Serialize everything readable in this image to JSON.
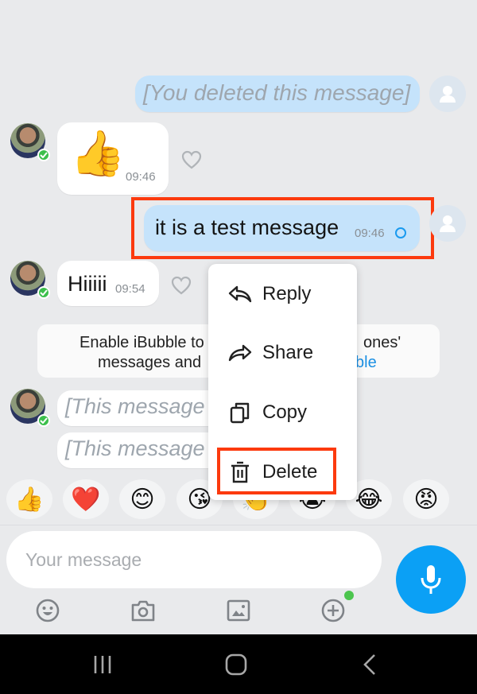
{
  "conversation": {
    "messages": [
      {
        "id": "m1",
        "direction": "outgoing",
        "type": "deleted",
        "text": "[You deleted this message]"
      },
      {
        "id": "m2",
        "direction": "incoming",
        "type": "sticker",
        "sticker": "thumbs-up",
        "glyph": "👍",
        "time": "09:46"
      },
      {
        "id": "m3",
        "direction": "outgoing",
        "type": "text",
        "text": "it is a test message",
        "time": "09:46",
        "status": "sending"
      },
      {
        "id": "m4",
        "direction": "incoming",
        "type": "text",
        "text": "Hiiiii",
        "time": "09:54"
      },
      {
        "id": "m5",
        "direction": "incoming",
        "type": "deleted",
        "text": "[This message"
      },
      {
        "id": "m6",
        "direction": "incoming",
        "type": "deleted",
        "text": "[This message"
      }
    ],
    "banner": {
      "line1_left": "Enable iBubble to",
      "line1_right": "ones'",
      "line2_left": "messages and",
      "line2_link": "ble"
    }
  },
  "context_menu": {
    "items": [
      {
        "label": "Reply",
        "icon": "reply-icon"
      },
      {
        "label": "Share",
        "icon": "share-icon"
      },
      {
        "label": "Copy",
        "icon": "copy-icon"
      },
      {
        "label": "Delete",
        "icon": "trash-icon",
        "highlighted": true
      }
    ]
  },
  "reactions": [
    {
      "name": "thumbs-up",
      "glyph": "👍"
    },
    {
      "name": "heart",
      "glyph": "❤️"
    },
    {
      "name": "smile",
      "glyph": "😊"
    },
    {
      "name": "kiss",
      "glyph": "😘"
    },
    {
      "name": "clap",
      "glyph": "👏"
    },
    {
      "name": "crying",
      "glyph": "😭"
    },
    {
      "name": "laugh",
      "glyph": "😂"
    },
    {
      "name": "angry",
      "glyph": "😡"
    }
  ],
  "composer": {
    "placeholder": "Your message",
    "value": "",
    "tools": [
      "emoji-icon",
      "camera-icon",
      "gallery-icon",
      "add-icon"
    ],
    "add_has_notification": true
  },
  "colors": {
    "accent": "#0ba0f5",
    "outgoing_bubble": "#c5e3fb",
    "highlight": "#fc3a0e",
    "verified": "#3cbf4c",
    "link": "#1a8fe3"
  }
}
